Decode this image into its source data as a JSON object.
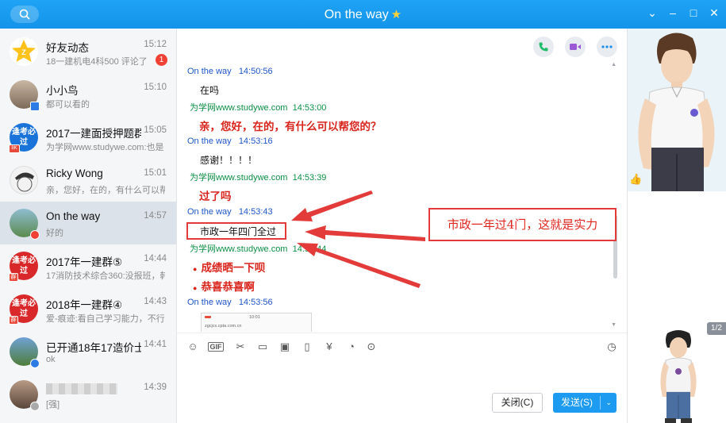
{
  "window": {
    "title": "On the way",
    "controls": [
      "chevron-down",
      "minimize",
      "maximize",
      "close"
    ]
  },
  "contacts": [
    {
      "name": "好友动态",
      "time": "15:12",
      "preview": "18一建机电4科500  评论了",
      "badge": "1"
    },
    {
      "name": "小小鸟",
      "time": "15:10",
      "preview": "都可以看的"
    },
    {
      "name": "2017一建面授押题群",
      "time": "15:05",
      "preview": "为学网www.studywe.com:也是",
      "avatar_text": "逢考必过",
      "tag": "8K"
    },
    {
      "name": "Ricky Wong",
      "time": "15:01",
      "preview": "亲，您好，在的，有什么可以帮"
    },
    {
      "name": "On the way",
      "time": "14:57",
      "preview": "好的"
    },
    {
      "name": "2017年一建群⑤",
      "time": "14:44",
      "preview": "17消防技术综合360:没报班，韩",
      "avatar_text": "逢考必过",
      "tag": "群"
    },
    {
      "name": "2018年一建群④",
      "time": "14:43",
      "preview": "爱-痕迹:看自己学习能力，不行",
      "avatar_text": "逢考必过",
      "tag": "群"
    },
    {
      "name": "已开通18年17造价士",
      "time": "14:41",
      "preview": "ok"
    },
    {
      "name": "",
      "time": "14:39",
      "preview": "[强]"
    }
  ],
  "chat": {
    "messages": [
      {
        "sender": "On the way",
        "time": "14:50:56",
        "text": "在吗"
      },
      {
        "sender": "为学网www.studywe.com",
        "time": "14:53:00",
        "text": "亲，您好，在的，有什么可以帮您的？"
      },
      {
        "sender": "On the way",
        "time": "14:53:16",
        "text": "感谢！！！！"
      },
      {
        "sender": "为学网www.studywe.com",
        "time": "14:53:39",
        "text": "过了吗"
      },
      {
        "sender": "On the way",
        "time": "14:53:43",
        "text": "市政一年四门全过"
      },
      {
        "sender": "为学网www.studywe.com",
        "time": "14:53:44",
        "texts": [
          "成绩晒一下呗",
          "恭喜恭喜啊"
        ]
      },
      {
        "sender": "On the way",
        "time": "14:53:56",
        "image_url_text": "zgcjcx.cpta.com.cn",
        "image_time_text": "10:01"
      }
    ],
    "toolbar_icons": [
      "emoji-icon",
      "gif-icon",
      "scissors-icon",
      "folder-icon",
      "image-icon",
      "shake-icon",
      "red-packet-icon",
      "more-icon",
      "history-icon"
    ],
    "close_label": "关闭(C)",
    "send_label": "发送(S)"
  },
  "annotation": {
    "text": "市政一年过4门，这就是实力",
    "color": "#e0261e"
  },
  "right_panel": {
    "page_indicator": "1/2"
  },
  "colors": {
    "accent": "#1c9bf0",
    "sender_me": "#1f56c9",
    "sender_them": "#0d8f45",
    "red_text": "#d9241c"
  }
}
